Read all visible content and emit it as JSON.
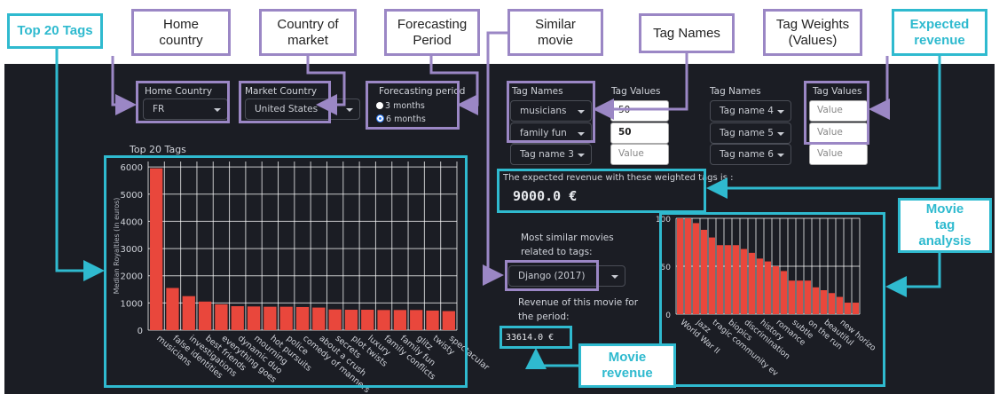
{
  "annotations": {
    "top20": "Top 20 Tags",
    "home_country": "Home\ncountry",
    "country_market": "Country of\nmarket",
    "forecasting": "Forecasting\nPeriod",
    "similar_movie": "Similar\nmovie",
    "tag_names": "Tag Names",
    "tag_weights": "Tag Weights\n(Values)",
    "expected_revenue": "Expected\nrevenue",
    "movie_tag_analysis": "Movie\ntag\nanalysis",
    "movie_revenue": "Movie\nrevenue"
  },
  "controls": {
    "home_country_label": "Home Country",
    "home_country_value": "FR",
    "market_country_label": "Market Country",
    "market_country_value": "United States",
    "forecast_label": "Forecasting period",
    "forecast_options": [
      "3 months",
      "6 months"
    ],
    "forecast_selected": "6 months"
  },
  "tags": {
    "names_header": "Tag Names",
    "values_header": "Tag Values",
    "names_header2": "Tag Names",
    "values_header2": "Tag Values",
    "rows": [
      {
        "name": "musicians",
        "value": "50"
      },
      {
        "name": "family fun",
        "value": "50"
      },
      {
        "name": "Tag name 3",
        "value": ""
      },
      {
        "name": "Tag name 4",
        "value": ""
      },
      {
        "name": "Tag name 5",
        "value": ""
      },
      {
        "name": "Tag name 6",
        "value": ""
      }
    ],
    "value_placeholder": "Value"
  },
  "revenue": {
    "text": "The expected revenue with these weighted tags is :",
    "value": "9000.0 €"
  },
  "similar": {
    "label_line1": "Most similar movies",
    "label_line2": "related to tags:",
    "selected": "Django (2017)",
    "rev_label_line1": "Revenue of this movie for",
    "rev_label_line2": "the period:",
    "rev_value": "33614.0 €"
  },
  "chart_data": [
    {
      "type": "bar",
      "title": "Top 20 Tags",
      "ylabel": "Median Royalties (in euros)",
      "ylim": [
        0,
        6200
      ],
      "yticks": [
        0,
        1000,
        2000,
        3000,
        4000,
        5000,
        6000
      ],
      "color": "#e9473c",
      "categories": [
        "musicians",
        "false identities",
        "investigations",
        "best friends",
        "everything goes",
        "dynamic duo",
        "mourning",
        "hot pursuits",
        "police",
        "comedy of manners",
        "about a crush",
        "secrets",
        "plot twists",
        "luxury",
        "family conflicts",
        "family fun",
        "glitz",
        "twisty",
        "spectacular"
      ],
      "values": [
        5950,
        1550,
        1250,
        1050,
        950,
        880,
        870,
        860,
        860,
        850,
        830,
        760,
        750,
        750,
        740,
        740,
        740,
        720,
        700
      ]
    },
    {
      "type": "bar",
      "title": "",
      "ylim": [
        0,
        100
      ],
      "yticks": [
        0,
        50,
        100
      ],
      "color": "#e9473c",
      "categories": [
        "World War II",
        "",
        "jazz",
        "",
        "tragic community ev",
        "",
        "biopics",
        "",
        "discrimination",
        "",
        "history",
        "",
        "romance",
        "",
        "subtle",
        "",
        "on the run",
        "",
        "beautiful",
        "",
        "new horizo"
      ],
      "values": [
        100,
        100,
        95,
        88,
        80,
        72,
        72,
        72,
        68,
        64,
        58,
        55,
        50,
        45,
        35,
        35,
        35,
        28,
        25,
        22,
        18,
        12,
        12
      ]
    }
  ]
}
